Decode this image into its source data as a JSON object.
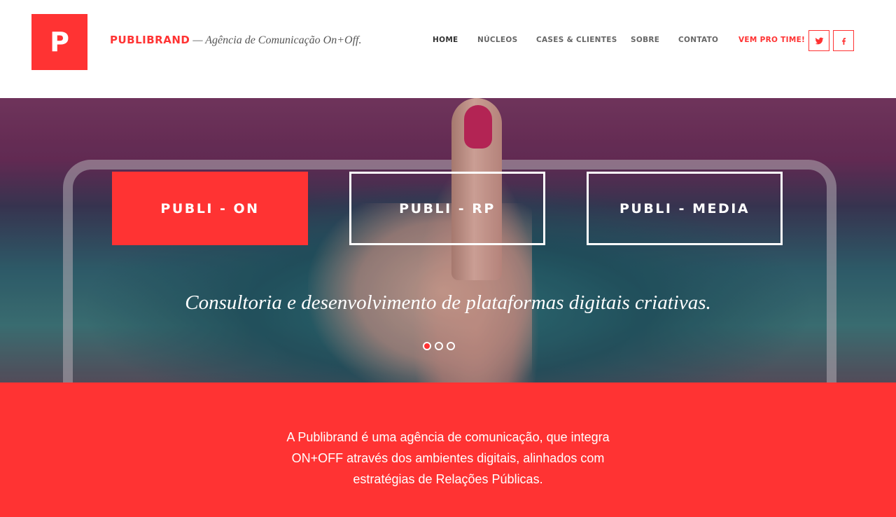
{
  "header": {
    "logo_letter": "P",
    "brand_name": "PUBLIBRAND",
    "brand_tagline": " — Agência de Comunicação On+Off."
  },
  "nav": {
    "items": [
      {
        "label": "HOME"
      },
      {
        "label": "NÚCLEOS"
      },
      {
        "label": "CASES & CLIENTES"
      },
      {
        "label": "SOBRE"
      },
      {
        "label": "CONTATO"
      },
      {
        "label": "VEM PRO TIME!"
      }
    ],
    "social": [
      {
        "icon": "twitter-icon"
      },
      {
        "icon": "facebook-icon"
      }
    ]
  },
  "hero": {
    "tiles": [
      {
        "label": "PUBLI - ON"
      },
      {
        "label": "PUBLI - RP"
      },
      {
        "label": "PUBLI - MEDIA"
      }
    ],
    "caption": "Consultoria e desenvolvimento de plataformas digitais criativas.",
    "slider": {
      "count": 3,
      "active_index": 0
    }
  },
  "intro": {
    "text": "A Publibrand é uma agência de comunicação, que integra ON+OFF através dos ambientes digitais, alinhados com estratégias de Relações Públicas."
  },
  "colors": {
    "accent": "#ff3333",
    "nav_text": "#666666",
    "white": "#ffffff"
  }
}
